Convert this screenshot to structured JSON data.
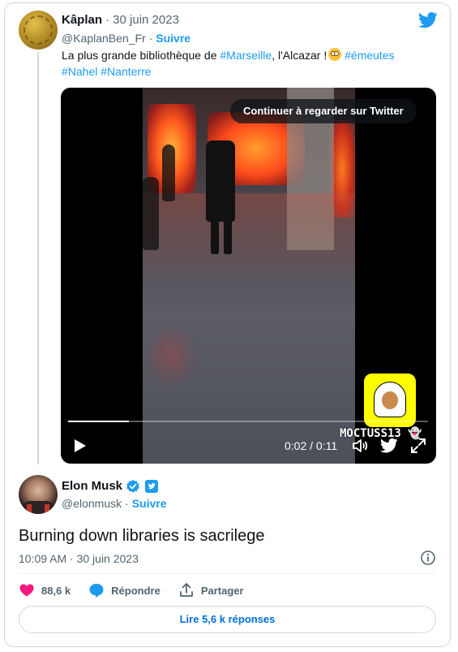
{
  "quoted_tweet": {
    "author_name": "Kâplan",
    "date": "· 30 juin 2023",
    "handle": "@KaplanBen_Fr ·",
    "follow_label": "Suivre",
    "text_part1": "La plus grande bibliothèque de ",
    "hashtag_marseille": "#Marseille",
    "text_part2": ", l'Alcazar !",
    "hashtag_emeutes": "#émeutes",
    "hashtag_nahel": "#Nahel",
    "hashtag_nanterre": "#Nanterre"
  },
  "video": {
    "continue_label": "Continuer à regarder sur Twitter",
    "watermark": "MOCTUSS13 👻",
    "time": "0:02 / 0:11",
    "progress": 0.17
  },
  "main_tweet": {
    "author_name": "Elon Musk",
    "handle": "@elonmusk ·",
    "follow_label": "Suivre",
    "text": "Burning down libraries is sacrilege",
    "timestamp": "10:09 AM · 30 juin 2023"
  },
  "actions": {
    "likes": "88,6 k",
    "reply_label": "Répondre",
    "share_label": "Partager"
  },
  "read_replies_label": "Lire 5,6 k réponses",
  "colors": {
    "accent": "#1d9bf0",
    "like": "#f91880",
    "link_button": "#006fd6",
    "muted": "#536471"
  },
  "icons": [
    "twitter-bird-icon",
    "play-icon",
    "volume-icon",
    "twitter-icon",
    "fullscreen-icon",
    "verified-icon",
    "business-badge-icon",
    "info-icon",
    "heart-icon",
    "reply-icon",
    "share-icon"
  ]
}
